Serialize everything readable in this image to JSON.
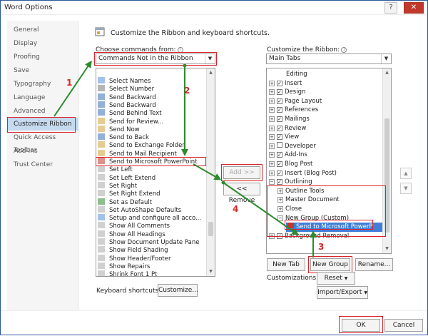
{
  "window": {
    "title": "Word Options",
    "help_glyph": "?",
    "close_glyph": "✕"
  },
  "nav": {
    "items": [
      {
        "label": "General"
      },
      {
        "label": "Display"
      },
      {
        "label": "Proofing"
      },
      {
        "label": "Save"
      },
      {
        "label": "Typography"
      },
      {
        "label": "Language"
      },
      {
        "label": "Advanced"
      },
      {
        "label": "Customize Ribbon",
        "selected": true
      },
      {
        "label": "Quick Access Toolbar"
      },
      {
        "label": "Add-Ins"
      },
      {
        "label": "Trust Center"
      }
    ]
  },
  "header": {
    "text": "Customize the Ribbon and keyboard shortcuts."
  },
  "left": {
    "choose_label": "Choose commands from:",
    "choose_value": "Commands Not in the Ribbon",
    "items": [
      "Select Names",
      "Select Number",
      "Send Backward",
      "Send Backward",
      "Send Behind Text",
      "Send for Review...",
      "Send Now",
      "Send to Back",
      "Send to Exchange Folder",
      "Send to Mail Recipient",
      "Send to Microsoft PowerPoint",
      "Set Left",
      "Set Left Extend",
      "Set Right",
      "Set Right Extend",
      "Set as Default",
      "Set AutoShape Defaults",
      "Setup and configure all acco...",
      "Show All Comments",
      "Show All Headings",
      "Show Document Update Pane",
      "Show Field Shading",
      "Show Header/Footer",
      "Show Repairs",
      "Shrink Font 1 Pt"
    ],
    "keyboard_label": "Keyboard shortcuts:",
    "customize_btn": "Customize..."
  },
  "middle": {
    "add_btn": "Add >>",
    "remove_btn": "<< Remove"
  },
  "right": {
    "customize_label": "Customize the Ribbon:",
    "customize_value": "Main Tabs",
    "items": [
      {
        "label": "Editing",
        "indent": 2,
        "exp": "",
        "chk": false
      },
      {
        "label": "Insert",
        "indent": 0,
        "exp": "+",
        "chk": true
      },
      {
        "label": "Design",
        "indent": 0,
        "exp": "+",
        "chk": true
      },
      {
        "label": "Page Layout",
        "indent": 0,
        "exp": "+",
        "chk": true
      },
      {
        "label": "References",
        "indent": 0,
        "exp": "+",
        "chk": true
      },
      {
        "label": "Mailings",
        "indent": 0,
        "exp": "+",
        "chk": true
      },
      {
        "label": "Review",
        "indent": 0,
        "exp": "+",
        "chk": true
      },
      {
        "label": "View",
        "indent": 0,
        "exp": "+",
        "chk": true
      },
      {
        "label": "Developer",
        "indent": 0,
        "exp": "+",
        "chk": false
      },
      {
        "label": "Add-Ins",
        "indent": 0,
        "exp": "+",
        "chk": true
      },
      {
        "label": "Blog Post",
        "indent": 0,
        "exp": "+",
        "chk": true
      },
      {
        "label": "Insert (Blog Post)",
        "indent": 0,
        "exp": "+",
        "chk": true
      },
      {
        "label": "Outlining",
        "indent": 0,
        "exp": "−",
        "chk": true
      },
      {
        "label": "Outline Tools",
        "indent": 1,
        "exp": "+",
        "chk": null
      },
      {
        "label": "Master Document",
        "indent": 1,
        "exp": "+",
        "chk": null
      },
      {
        "label": "Close",
        "indent": 1,
        "exp": "+",
        "chk": null
      },
      {
        "label": "New Group (Custom)",
        "indent": 1,
        "exp": "−",
        "chk": null
      },
      {
        "label": "Send to Microsoft PowerP",
        "indent": 2,
        "exp": "",
        "chk": null,
        "selected": true
      },
      {
        "label": "Background Removal",
        "indent": 0,
        "exp": "+",
        "chk": true
      }
    ],
    "new_tab_btn": "New Tab",
    "new_group_btn": "New Group",
    "rename_btn": "Rename...",
    "customizations_label": "Customizations:",
    "reset_btn": "Reset",
    "import_export_btn": "Import/Export"
  },
  "footer": {
    "ok_btn": "OK",
    "cancel_btn": "Cancel"
  },
  "annotations": [
    "1",
    "2",
    "3",
    "4"
  ],
  "colors": {
    "annotation_red": "#d9242a",
    "arrow_green": "#2e8b2e",
    "selection_blue": "#3f7fd8",
    "nav_selected": "#c5d9ef"
  }
}
